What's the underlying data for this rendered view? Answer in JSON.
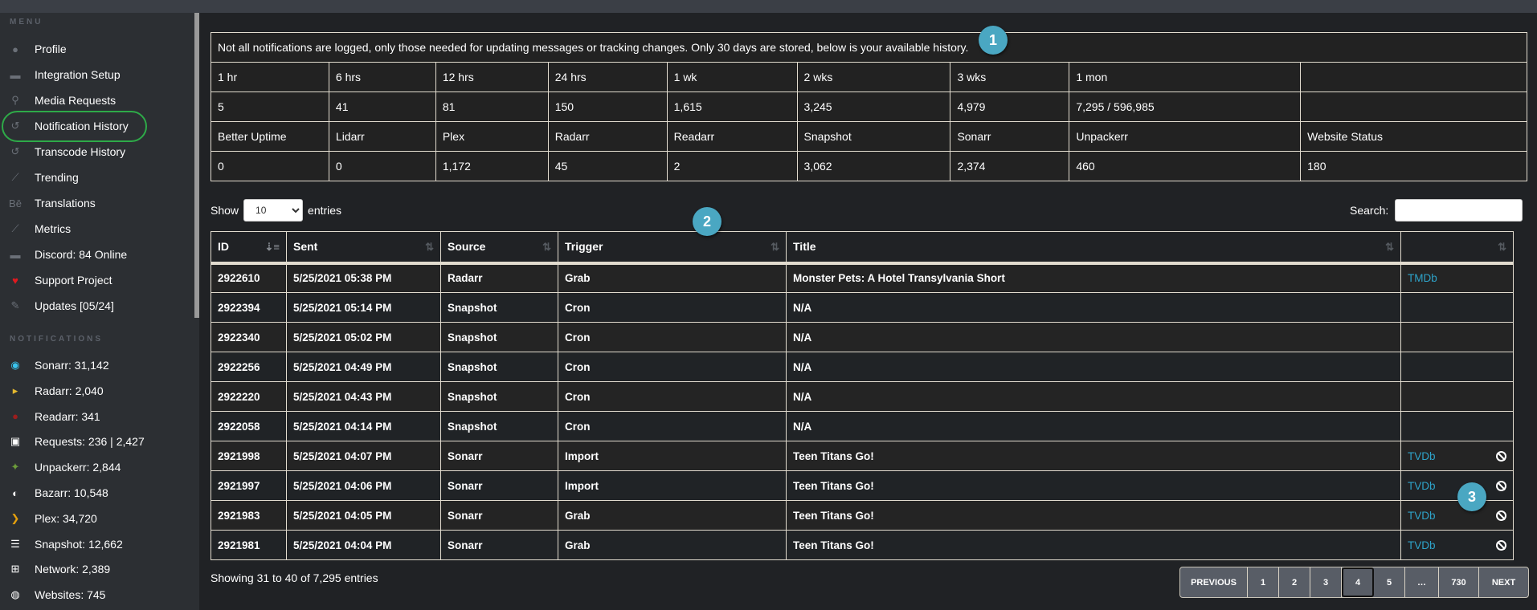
{
  "sidebar": {
    "menu_label": "MENU",
    "menu": [
      {
        "label": "Profile",
        "icon": "user-icon"
      },
      {
        "label": "Integration Setup",
        "icon": "discord-icon"
      },
      {
        "label": "Media Requests",
        "icon": "search-icon"
      },
      {
        "label": "Notification History",
        "icon": "history-icon",
        "active": true
      },
      {
        "label": "Transcode History",
        "icon": "history-icon"
      },
      {
        "label": "Trending",
        "icon": "chart-icon"
      },
      {
        "label": "Translations",
        "icon": "behance-icon"
      },
      {
        "label": "Metrics",
        "icon": "chart-icon"
      },
      {
        "label": "Discord: 84 Online",
        "icon": "discord-icon"
      },
      {
        "label": "Support Project",
        "icon": "heart-icon"
      },
      {
        "label": "Updates [05/24]",
        "icon": "edit-icon"
      }
    ],
    "notifications_label": "NOTIFICATIONS",
    "notifications": [
      {
        "label": "Sonarr: 31,142",
        "icon": "sonarr-icon"
      },
      {
        "label": "Radarr: 2,040",
        "icon": "radarr-icon"
      },
      {
        "label": "Readarr: 341",
        "icon": "readarr-icon"
      },
      {
        "label": "Requests: 236 | 2,427",
        "icon": "robot-icon"
      },
      {
        "label": "Unpackerr: 2,844",
        "icon": "unpackerr-icon"
      },
      {
        "label": "Bazarr: 10,548",
        "icon": "bazarr-icon"
      },
      {
        "label": "Plex: 34,720",
        "icon": "plex-icon"
      },
      {
        "label": "Snapshot: 12,662",
        "icon": "server-icon"
      },
      {
        "label": "Network: 2,389",
        "icon": "network-icon"
      },
      {
        "label": "Websites: 745",
        "icon": "globe-icon"
      }
    ]
  },
  "stats": {
    "notice": "Not all notifications are logged, only those needed for updating messages or tracking changes. Only 30 days are stored, below is your available history.",
    "periods": [
      "1 hr",
      "6 hrs",
      "12 hrs",
      "24 hrs",
      "1 wk",
      "2 wks",
      "3 wks",
      "1 mon",
      ""
    ],
    "period_counts": [
      "5",
      "41",
      "81",
      "150",
      "1,615",
      "3,245",
      "4,979",
      "7,295 / 596,985",
      ""
    ],
    "sources": [
      "Better Uptime",
      "Lidarr",
      "Plex",
      "Radarr",
      "Readarr",
      "Snapshot",
      "Sonarr",
      "Unpackerr",
      "Website Status"
    ],
    "source_counts": [
      "0",
      "0",
      "1,172",
      "45",
      "2",
      "3,062",
      "2,374",
      "460",
      "180"
    ]
  },
  "controls": {
    "show": "Show",
    "entries": "entries",
    "page_size": "10",
    "search_label": "Search:",
    "search_value": ""
  },
  "table": {
    "columns": [
      "ID",
      "Sent",
      "Source",
      "Trigger",
      "Title",
      ""
    ],
    "rows": [
      [
        "2922610",
        "5/25/2021 05:38 PM",
        "Radarr",
        "Grab",
        "Monster Pets: A Hotel Transylvania Short",
        "TMDb",
        false
      ],
      [
        "2922394",
        "5/25/2021 05:14 PM",
        "Snapshot",
        "Cron",
        "N/A",
        "",
        false
      ],
      [
        "2922340",
        "5/25/2021 05:02 PM",
        "Snapshot",
        "Cron",
        "N/A",
        "",
        false
      ],
      [
        "2922256",
        "5/25/2021 04:49 PM",
        "Snapshot",
        "Cron",
        "N/A",
        "",
        false
      ],
      [
        "2922220",
        "5/25/2021 04:43 PM",
        "Snapshot",
        "Cron",
        "N/A",
        "",
        false
      ],
      [
        "2922058",
        "5/25/2021 04:14 PM",
        "Snapshot",
        "Cron",
        "N/A",
        "",
        false
      ],
      [
        "2921998",
        "5/25/2021 04:07 PM",
        "Sonarr",
        "Import",
        "Teen Titans Go!",
        "TVDb",
        true
      ],
      [
        "2921997",
        "5/25/2021 04:06 PM",
        "Sonarr",
        "Import",
        "Teen Titans Go!",
        "TVDb",
        true
      ],
      [
        "2921983",
        "5/25/2021 04:05 PM",
        "Sonarr",
        "Grab",
        "Teen Titans Go!",
        "TVDb",
        true
      ],
      [
        "2921981",
        "5/25/2021 04:04 PM",
        "Sonarr",
        "Grab",
        "Teen Titans Go!",
        "TVDb",
        true
      ]
    ]
  },
  "footer": {
    "info": "Showing 31 to 40 of 7,295 entries",
    "pages": [
      "PREVIOUS",
      "1",
      "2",
      "3",
      "4",
      "5",
      "…",
      "730",
      "NEXT"
    ],
    "current_page": "4"
  },
  "badges": [
    "1",
    "2",
    "3"
  ],
  "colors": {
    "accent": "#4aa7c2",
    "link": "#2ea3c9",
    "highlight": "#2eaa48",
    "heart": "#e0191f"
  }
}
